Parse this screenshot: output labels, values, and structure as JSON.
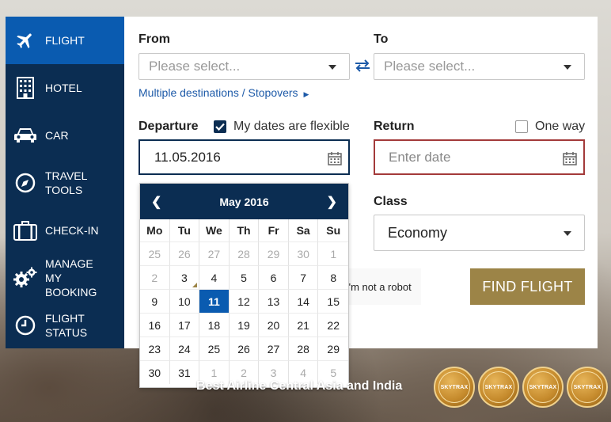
{
  "sidebar": {
    "items": [
      {
        "label": "FLIGHT",
        "icon": "plane-icon",
        "active": true
      },
      {
        "label": "HOTEL",
        "icon": "building-icon"
      },
      {
        "label": "CAR",
        "icon": "car-icon"
      },
      {
        "label": "TRAVEL TOOLS",
        "icon": "compass-icon"
      },
      {
        "label": "CHECK-IN",
        "icon": "suitcase-icon"
      },
      {
        "label": "MANAGE MY BOOKING",
        "icon": "gears-icon"
      },
      {
        "label": "FLIGHT STATUS",
        "icon": "clock-icon"
      }
    ]
  },
  "form": {
    "from_label": "From",
    "to_label": "To",
    "from_placeholder": "Please select...",
    "to_placeholder": "Please select...",
    "multi_link": "Multiple destinations / Stopovers",
    "departure_label": "Departure",
    "flexible_label": "My dates are flexible",
    "flexible_checked": true,
    "return_label": "Return",
    "oneway_label": "One way",
    "oneway_checked": false,
    "departure_value": "11.05.2016",
    "return_placeholder": "Enter date",
    "class_label": "Class",
    "class_value": "Economy",
    "robot_text": "I'm not a robot",
    "find_button": "FIND FLIGHT"
  },
  "calendar": {
    "month_label": "May 2016",
    "prev": "❮",
    "next": "❯",
    "weekdays": [
      "Mo",
      "Tu",
      "We",
      "Th",
      "Fr",
      "Sa",
      "Su"
    ],
    "weeks": [
      [
        "25",
        "26",
        "27",
        "28",
        "29",
        "30",
        "1"
      ],
      [
        "2",
        "3",
        "4",
        "5",
        "6",
        "7",
        "8"
      ],
      [
        "9",
        "10",
        "11",
        "12",
        "13",
        "14",
        "15"
      ],
      [
        "16",
        "17",
        "18",
        "19",
        "20",
        "21",
        "22"
      ],
      [
        "23",
        "24",
        "25",
        "26",
        "27",
        "28",
        "29"
      ],
      [
        "30",
        "31",
        "1",
        "2",
        "3",
        "4",
        "5"
      ]
    ],
    "selected_day": "11"
  },
  "award": {
    "text": "Best Airline Central Asia and India",
    "badge_label": "SKYTRAX",
    "badge_count": 4
  },
  "colors": {
    "navy": "#0b2d52",
    "active_blue": "#0a5bb0",
    "gold": "#9c8447",
    "error_red": "#a33a3a"
  }
}
